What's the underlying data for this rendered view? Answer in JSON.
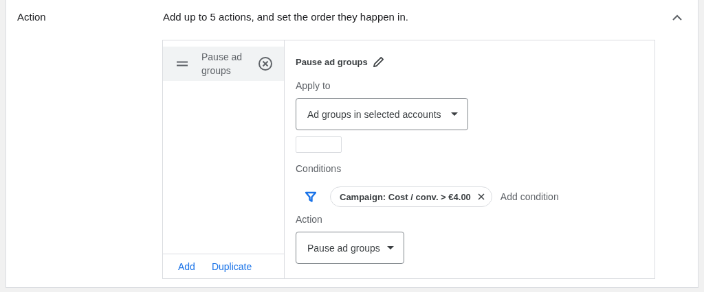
{
  "section": {
    "title": "Action",
    "description": "Add up to 5 actions, and set the order they happen in.",
    "expanded": true
  },
  "actions": [
    {
      "label": "Pause ad groups",
      "selected": true
    }
  ],
  "footer_links": [
    "Add",
    "Duplicate"
  ],
  "editor": {
    "title": "Pause ad groups",
    "apply_to": {
      "label": "Apply to",
      "value": "Ad groups in selected accounts"
    },
    "conditions": {
      "label": "Conditions",
      "chips": [
        "Campaign: Cost / conv. > €4.00"
      ],
      "add_label": "Add condition"
    },
    "action": {
      "label": "Action",
      "value": "Pause ad groups"
    }
  }
}
